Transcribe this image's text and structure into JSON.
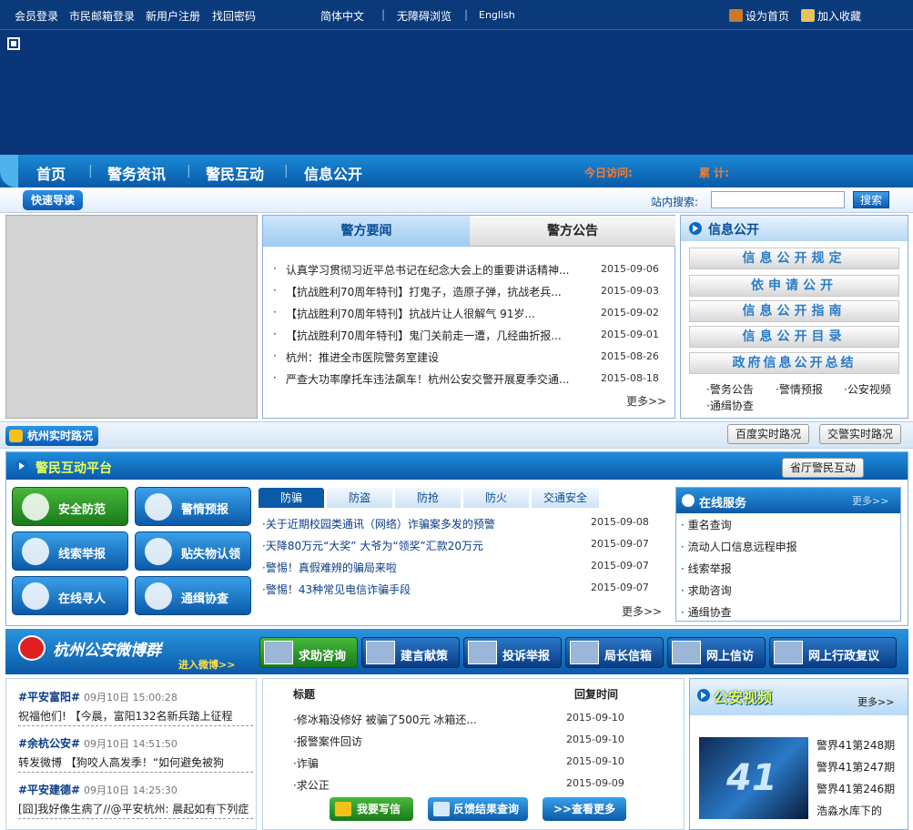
{
  "topbar": {
    "links": [
      "会员登录",
      "市民邮箱登录",
      "新用户注册",
      "找回密码"
    ],
    "lang": [
      "简体中文",
      "无障碍浏览",
      "English"
    ],
    "set_home": "设为首页",
    "favorite": "加入收藏"
  },
  "nav": {
    "items": [
      "首页",
      "警务资讯",
      "警民互动",
      "信息公开"
    ],
    "today_visits": "今日访问:",
    "total": "累 计:"
  },
  "quick": {
    "guide": "快速导读",
    "search_label": "站内搜索:",
    "search_value": "",
    "search_button": "搜索"
  },
  "news": {
    "tabs": [
      "警方要闻",
      "警方公告"
    ],
    "items": [
      {
        "title": "认真学习贯彻习近平总书记在纪念大会上的重要讲话精神...",
        "date": "2015-09-06"
      },
      {
        "title": "【抗战胜利70周年特刊】打鬼子，造原子弹，抗战老兵...",
        "date": "2015-09-03"
      },
      {
        "title": "【抗战胜利70周年特刊】抗战片让人很解气 91岁...",
        "date": "2015-09-02"
      },
      {
        "title": "【抗战胜利70周年特刊】鬼门关前走一遭，几经曲折报...",
        "date": "2015-09-01"
      },
      {
        "title": "杭州：推进全市医院警务室建设",
        "date": "2015-08-26"
      },
      {
        "title": "严查大功率摩托车违法飙车！杭州公安交警开展夏季交通...",
        "date": "2015-08-18"
      }
    ],
    "more": "更多>>"
  },
  "info": {
    "title": "信息公开",
    "buttons": [
      "信息公开规定",
      "依申请公开",
      "信息公开指南",
      "信息公开目录",
      "政府信息公开总结"
    ],
    "links": [
      "·警务公告",
      "·警情预报",
      "·公安视频",
      "·通缉协查"
    ]
  },
  "road": {
    "label": "杭州实时路况",
    "baidu": "百度实时路况",
    "police": "交警实时路况"
  },
  "platform": {
    "title": "警民互动平台",
    "province_button": "省厅警民互动",
    "buttons": [
      "安全防范",
      "警情预报",
      "线索举报",
      "贴失物认领",
      "在线寻人",
      "通缉协查"
    ],
    "tabs": [
      "防骗",
      "防盗",
      "防抢",
      "防火",
      "交通安全"
    ],
    "items": [
      {
        "title": "·关于近期校园类通讯（网络）诈骗案多发的预警",
        "date": "2015-09-08"
      },
      {
        "title": "·天降80万元“大奖” 大爷为“领奖”汇款20万元",
        "date": "2015-09-07"
      },
      {
        "title": "·警惕！真假难辨的骗局来啦",
        "date": "2015-09-07"
      },
      {
        "title": "·警惕！43种常见电信诈骗手段",
        "date": "2015-09-07"
      }
    ],
    "more": "更多>>"
  },
  "service": {
    "title": "在线服务",
    "more": "更多>>",
    "items": [
      "重名查询",
      "流动人口信息远程申报",
      "线索举报",
      "求助咨询",
      "通缉协查"
    ]
  },
  "weibo": {
    "title": "杭州公安微博群",
    "subtitle": "进入微博>>",
    "tabs": [
      "求助咨询",
      "建言献策",
      "投诉举报",
      "局长信箱",
      "网上信访",
      "网上行政复议"
    ],
    "posts": [
      {
        "tag": "#平安富阳#",
        "time": "09月10日 15:00:28",
        "text": "祝福他们! 【今晨，富阳132名新兵踏上征程"
      },
      {
        "tag": "#余杭公安#",
        "time": "09月10日 14:51:50",
        "text": "转发微博 【狗咬人高发季！“如何避免被狗"
      },
      {
        "tag": "#平安建德#",
        "time": "09月10日 14:25:30",
        "text": "[囧]我好像生病了//@平安杭州: 晨起如有下列症"
      }
    ]
  },
  "ask": {
    "col_title": "标题",
    "col_time": "回复时间",
    "items": [
      {
        "title": "·修冰箱没修好 被骗了500元 冰箱还...",
        "date": "2015-09-10"
      },
      {
        "title": "·报警案件回访",
        "date": "2015-09-10"
      },
      {
        "title": "·诈骗",
        "date": "2015-09-10"
      },
      {
        "title": "·求公正",
        "date": "2015-09-09"
      }
    ],
    "write": "我要写信",
    "feedback": "反馈结果查询",
    "view_more": ">>查看更多"
  },
  "video": {
    "title": "公安视频",
    "more": "更多>>",
    "thumb_text": "41",
    "items": [
      "警界41第248期",
      "警界41第247期",
      "警界41第246期",
      "浩淼水库下的"
    ]
  },
  "colors": {
    "navy": "#0b3579",
    "nav_blue": "#0a5aa8",
    "accent_green": "#eaff5a",
    "stat_orange": "#ff7a2a"
  }
}
